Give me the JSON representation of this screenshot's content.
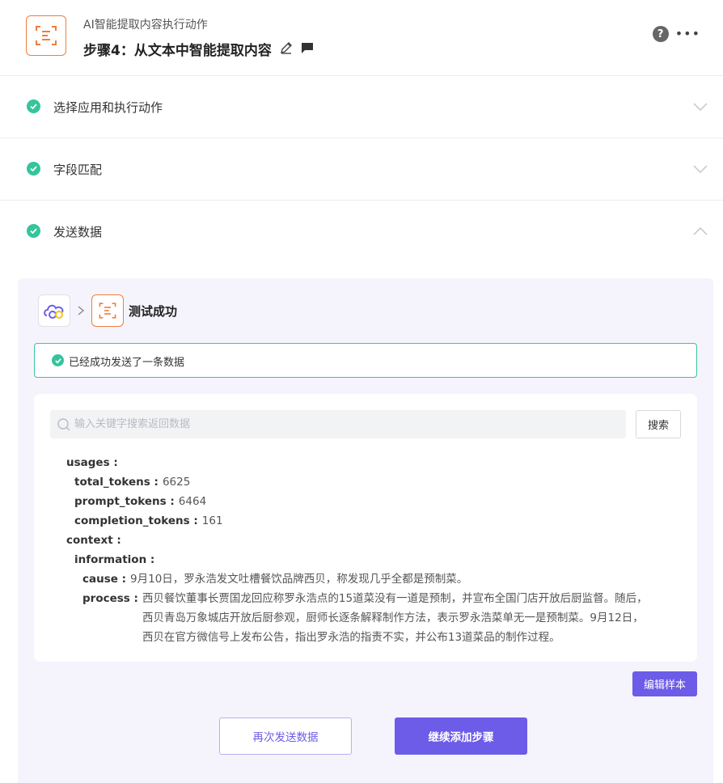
{
  "header": {
    "subtitle": "AI智能提取内容执行动作",
    "title": "步骤4：从文本中智能提取内容",
    "help_glyph": "?",
    "more_glyph": "•••",
    "icon": "ai-extract-icon"
  },
  "sections": [
    {
      "label": "选择应用和执行动作",
      "status": "done",
      "expanded": false
    },
    {
      "label": "字段匹配",
      "status": "done",
      "expanded": false
    },
    {
      "label": "发送数据",
      "status": "done",
      "expanded": true
    }
  ],
  "test_panel": {
    "status_title": "测试成功",
    "alert_text": "已经成功发送了一条数据",
    "search_placeholder": "输入关键字搜索返回数据",
    "search_button": "搜索",
    "data": {
      "usages_key": "usages",
      "total_tokens_key": "total_tokens",
      "total_tokens_value": "6625",
      "prompt_tokens_key": "prompt_tokens",
      "prompt_tokens_value": "6464",
      "completion_tokens_key": "completion_tokens",
      "completion_tokens_value": "161",
      "context_key": "context",
      "information_key": "information",
      "cause_key": "cause",
      "cause_value": "9月10日，罗永浩发文吐槽餐饮品牌西贝，称发现几乎全都是预制菜。",
      "process_key": "process",
      "process_value": "西贝餐饮董事长贾国龙回应称罗永浩点的15道菜没有一道是预制，并宣布全国门店开放后厨监督。随后，西贝青岛万象城店开放后厨参观，厨师长逐条解释制作方法，表示罗永浩菜单无一是预制菜。9月12日，西贝在官方微信号上发布公告，指出罗永浩的指责不实，并公布13道菜品的制作过程。"
    },
    "edit_sample_button": "编辑样本",
    "resend_button": "再次发送数据",
    "continue_button": "继续添加步骤"
  },
  "colors": {
    "accent": "#6c5ce7",
    "success": "#35c49b",
    "ai_orange": "#f07d3c"
  }
}
